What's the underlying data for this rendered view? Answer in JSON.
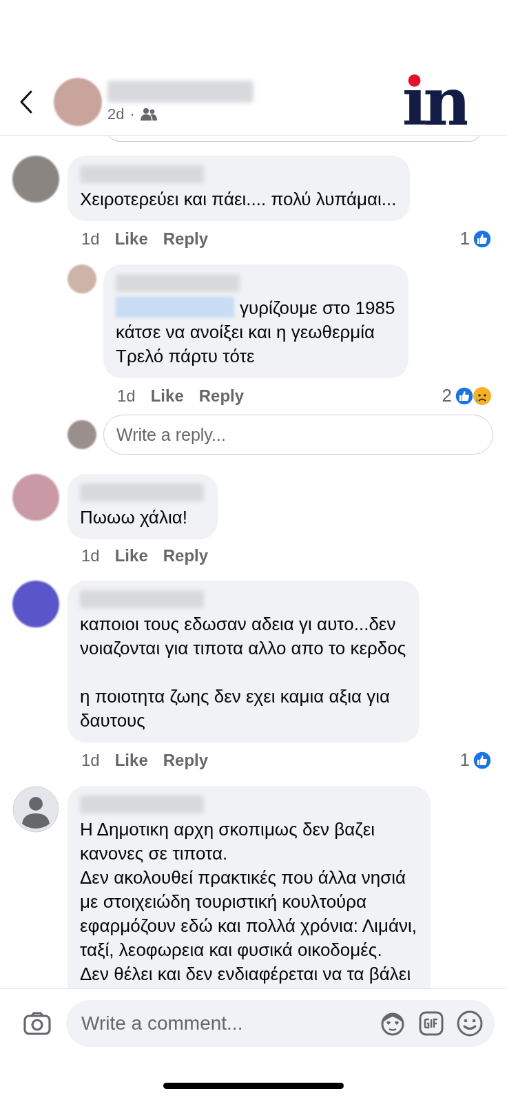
{
  "header": {
    "avatar": {
      "color": "#c9a49c"
    },
    "time": "2d",
    "separator": "·",
    "logo": "in"
  },
  "comments": [
    {
      "avatar": {
        "kind": "photo",
        "color": "#8a8580"
      },
      "text": "Χειροτερεύει και πάει.... πολύ λυπάμαι...",
      "time": "1d",
      "like": "Like",
      "reply": "Reply",
      "reactions": {
        "count": "1",
        "icons": [
          {
            "kind": "like"
          }
        ]
      },
      "replies": [
        {
          "avatar": {
            "color": "#cdb3a8"
          },
          "mention": true,
          "text": "γυρίζουμε στο 1985\nκάτσε να ανοίξει και η γεωθερμία\nΤρελό πάρτυ τότε",
          "time": "1d",
          "like": "Like",
          "reply": "Reply",
          "reactions": {
            "count": "2",
            "icons": [
              {
                "kind": "like"
              },
              {
                "kind": "sad"
              }
            ]
          }
        }
      ],
      "reply_box": {
        "avatar": {
          "color": "#9a8f8c"
        },
        "placeholder": "Write a reply..."
      }
    },
    {
      "avatar": {
        "kind": "photo",
        "color": "#c99aa6"
      },
      "text": "Πωωω χάλια!",
      "time": "1d",
      "like": "Like",
      "reply": "Reply"
    },
    {
      "avatar": {
        "kind": "photo",
        "color": "#5a55c8"
      },
      "text": "καποιοι τους εδωσαν αδεια γι αυτο...δεν\nνοιαζονται για τιποτα αλλο απο το κερδος\n\nη ποιοτητα ζωης δεν εχει καμια αξια για\nδαυτους",
      "time": "1d",
      "like": "Like",
      "reply": "Reply",
      "reactions": {
        "count": "1",
        "icons": [
          {
            "kind": "like"
          }
        ]
      }
    },
    {
      "avatar": {
        "kind": "silhouette"
      },
      "text": "Η Δημοτικη αρχη σκοπιμως δεν βαζει\nκανονες σε τιποτα.\nΔεν ακολουθεί πρακτικές που άλλα νησιά\nμε στοιχειώδη τουριστική κουλτούρα\nεφαρμόζουν εδώ και πολλά χρόνια: Λιμάνι,\nταξί, λεοφωρεια και φυσικά  οικοδομές.\nΔεν θέλει και δεν ενδιαφέρεται να τα βάλει"
    }
  ],
  "composer": {
    "placeholder": "Write a comment..."
  }
}
